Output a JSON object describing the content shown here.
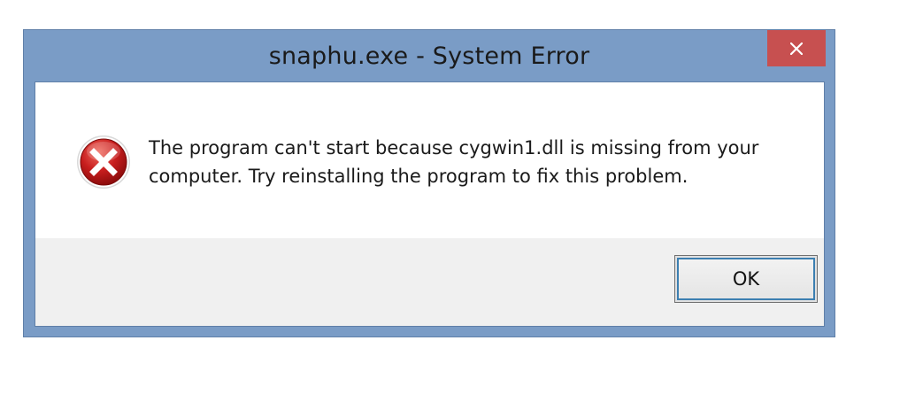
{
  "window": {
    "title": "snaphu.exe - System Error",
    "close_icon": "close-icon"
  },
  "dialog": {
    "icon": "error-icon",
    "message_line1": "The program can't start because cygwin1.dll is missing from your",
    "message_line2": "computer. Try reinstalling the program to fix this problem."
  },
  "buttons": {
    "ok_label": "OK"
  },
  "colors": {
    "frame": "#7a9cc6",
    "close_button": "#c75050",
    "content_bg": "#ffffff",
    "footer_bg": "#f0f0f0",
    "error_red": "#c81e1e"
  }
}
